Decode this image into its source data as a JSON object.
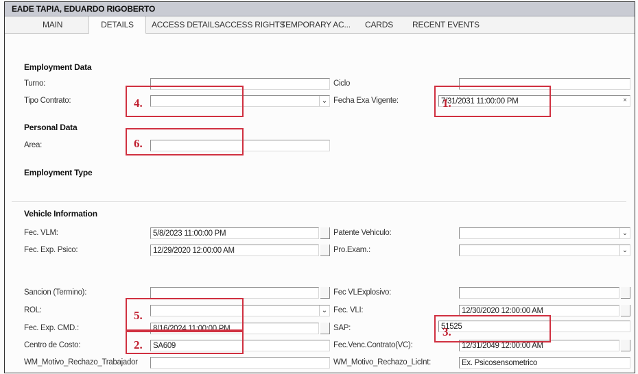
{
  "window": {
    "title": "EADE TAPIA, EDUARDO RIGOBERTO"
  },
  "tabs": [
    "MAIN",
    "DETAILS",
    "ACCESS DETAILS",
    "ACCESS RIGHTS",
    "TEMPORARY AC...",
    "CARDS",
    "RECENT EVENTS"
  ],
  "active_tab": "DETAILS",
  "sections": {
    "employment_data": "Employment Data",
    "personal_data": "Personal Data",
    "employment_type": "Employment Type",
    "vehicle_information": "Vehicle Information"
  },
  "labels": {
    "turno": "Turno:",
    "ciclo": "Ciclo",
    "tipo_contrato": "Tipo Contrato:",
    "fecha_exa_vigente": "Fecha Exa Vigente:",
    "area": "Area:",
    "fec_vlm": "Fec. VLM:",
    "patente_vehiculo": "Patente Vehiculo:",
    "fec_exp_psico": "Fec. Exp. Psico:",
    "pro_exam": "Pro.Exam.:",
    "sancion": "Sancion (Termino):",
    "fec_vl_explosivo": "Fec VLExplosivo:",
    "rol": "ROL:",
    "fec_vli": "Fec. VLI:",
    "fec_exp_cmd": "Fec. Exp. CMD.:",
    "sap": "SAP:",
    "centro_costo": "Centro de Costo:",
    "fec_venc_contrato": "Fec.Venc.Contrato(VC):",
    "wm_motivo_trabajador": "WM_Motivo_Rechazo_Trabajador",
    "wm_motivo_licint": "WM_Motivo_Rechazo_LicInt:"
  },
  "values": {
    "turno": "",
    "ciclo": "",
    "tipo_contrato": "",
    "fecha_exa_vigente": "7/31/2031 11:00:00 PM",
    "area": "",
    "fec_vlm": "5/8/2023 11:00:00 PM",
    "patente_vehiculo": "",
    "fec_exp_psico": "12/29/2020 12:00:00 AM",
    "pro_exam": "",
    "sancion": "",
    "fec_vl_explosivo": "",
    "rol": "",
    "fec_vli": "12/30/2020 12:00:00 AM",
    "fec_exp_cmd": "8/16/2024 11:00:00 PM",
    "sap": "51525",
    "centro_costo": "SA609",
    "fec_venc_contrato": "12/31/2049 12:00:00 AM",
    "wm_motivo_trabajador": "",
    "wm_motivo_licint": "Ex. Psicosensometrico"
  },
  "glyphs": {
    "dropdown": "⌄",
    "clear": "×"
  },
  "annotations": [
    "1.",
    "2.",
    "3.",
    "4.",
    "5.",
    "6."
  ],
  "colors": {
    "annotation": "#d03040",
    "title_bar": "#c9cbd3"
  }
}
